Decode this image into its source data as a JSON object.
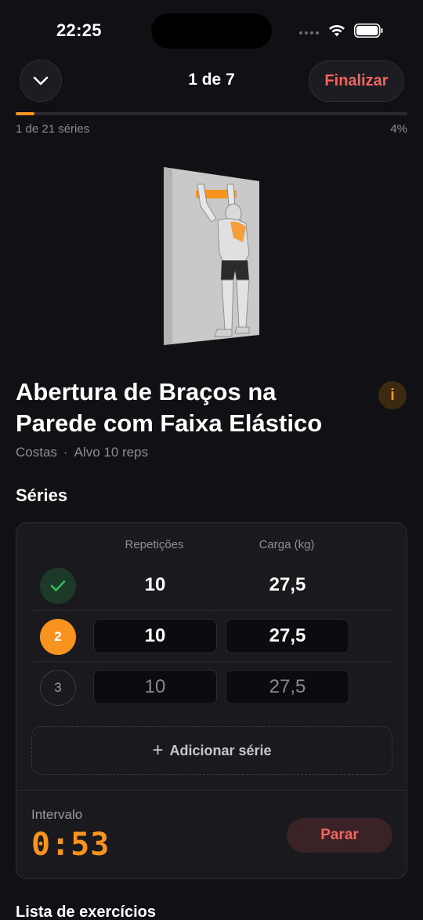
{
  "status": {
    "time": "22:25"
  },
  "header": {
    "title": "1 de 7",
    "finish_label": "Finalizar"
  },
  "progress": {
    "label": "1 de 21 séries",
    "percent_label": "4%",
    "fraction": 0.04
  },
  "exercise": {
    "title": "Abertura de Braços na Parede com Faixa Elástico",
    "info_label": "i",
    "muscle": "Costas",
    "separator": "·",
    "target": "Alvo 10 reps"
  },
  "series": {
    "section_title": "Séries",
    "col_reps": "Repetições",
    "col_load": "Carga (kg)",
    "rows": [
      {
        "number": "1",
        "state": "done",
        "reps": "10",
        "load": "27,5"
      },
      {
        "number": "2",
        "state": "active",
        "reps": "10",
        "load": "27,5"
      },
      {
        "number": "3",
        "state": "pending",
        "reps": "10",
        "load": "27,5"
      }
    ],
    "add_label": "Adicionar série",
    "add_icon": "+"
  },
  "interval": {
    "label": "Intervalo",
    "time": "0:53",
    "stop_label": "Parar"
  },
  "list": {
    "title": "Lista de exercícios"
  },
  "colors": {
    "accent": "#f7931e",
    "danger": "#f0665f",
    "background": "#111014",
    "card": "#1a191e",
    "done_green": "#2fbf5a"
  },
  "icons": {
    "collapse": "chevron-down-icon",
    "done": "check-icon",
    "wifi": "wifi-icon",
    "battery": "battery-icon",
    "signal": "signal-icon"
  }
}
